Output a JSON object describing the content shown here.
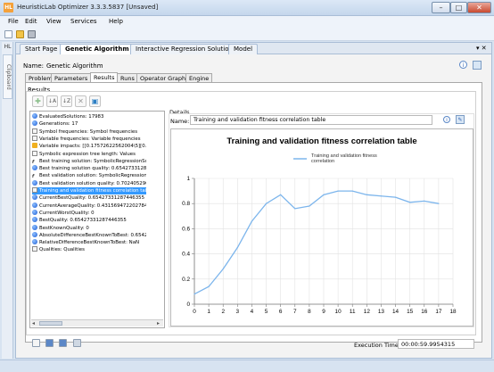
{
  "window": {
    "app_icon": "HL",
    "title": "HeuristicLab Optimizer 3.3.3.5837 [Unsaved]",
    "buttons": {
      "minimize": "–",
      "maximize": "□",
      "close": "✕"
    }
  },
  "menu": [
    "File",
    "Edit",
    "View",
    "Services",
    "Help"
  ],
  "toolbar_icons": [
    "new-file-icon",
    "open-folder-icon",
    "save-icon"
  ],
  "left_strip": {
    "top_tab": "HL",
    "clipboard_tab": "Clipboard"
  },
  "doc_tabs": [
    {
      "label": "Start Page",
      "active": false
    },
    {
      "label": "Genetic Algorithm",
      "active": true
    },
    {
      "label": "Interactive Regression Solution S...",
      "active": false
    },
    {
      "label": "Model",
      "active": false
    }
  ],
  "doc_menu_glyph": "▾ ✕",
  "name_row": {
    "label": "Name:",
    "value": "Genetic Algorithm"
  },
  "sub_tabs": [
    "Problem",
    "Parameters",
    "Results",
    "Runs",
    "Operator Graph",
    "Engine"
  ],
  "active_sub_tab": "Results",
  "results": {
    "group_label": "Results",
    "toolbar": [
      "add-icon",
      "sort-ascending-icon",
      "sort-descending-icon",
      "remove-icon",
      "refresh-icon"
    ],
    "toolbar_glyphs": [
      "✚",
      "↓A",
      "↓Z",
      "✕",
      "▣"
    ],
    "items": [
      {
        "icon": "dot",
        "text": "EvaluatedSolutions: 17983"
      },
      {
        "icon": "dot",
        "text": "Generations: 17"
      },
      {
        "icon": "chart",
        "text": "Symbol frequencies: Symbol frequencies"
      },
      {
        "icon": "chart",
        "text": "Variable frequencies: Variable frequencies"
      },
      {
        "icon": "vi",
        "text": "Variable impacts: [[0.17572622562004\\5][0.137"
      },
      {
        "icon": "chart",
        "text": "Symbolic expression tree length: Values"
      },
      {
        "icon": "fx",
        "text": "Best training solution: SymbolicRegressionSolu"
      },
      {
        "icon": "dot",
        "text": "Best training solution quality: 0.654273312874"
      },
      {
        "icon": "fx",
        "text": "Best validation solution: SymbolicRegressionS"
      },
      {
        "icon": "dot",
        "text": "Best validation solution quality: 0.70240529696"
      },
      {
        "icon": "chart",
        "text": "Training and validation fitness correlation table",
        "selected": true
      },
      {
        "icon": "dot",
        "text": "CurrentBestQuality: 0.65427331287446355"
      },
      {
        "icon": "dot",
        "text": "CurrentAverageQuality: 0.4315694722027848"
      },
      {
        "icon": "dot",
        "text": "CurrentWorstQuality: 0"
      },
      {
        "icon": "dot",
        "text": "BestQuality: 0.65427331287446355"
      },
      {
        "icon": "dot",
        "text": "BestKnownQuality: 0"
      },
      {
        "icon": "dot",
        "text": "AbsoluteDifferenceBestKnownToBest: 0.6542"
      },
      {
        "icon": "dot",
        "text": "RelativeDifferenceBestKnownToBest: NaN"
      },
      {
        "icon": "chart",
        "text": "Qualities: Qualities"
      }
    ]
  },
  "details": {
    "group_label": "Details",
    "name_label": "Name:",
    "name_value": "Training and validation fitness correlation table",
    "info_icon": "i",
    "edit_icon": "✎"
  },
  "chart_data": {
    "type": "line",
    "title": "Training and validation fitness correlation table",
    "series": [
      {
        "name": "Training and validation fitness correlation",
        "color": "#7cb5ec",
        "x": [
          0,
          1,
          2,
          3,
          4,
          5,
          6,
          7,
          8,
          9,
          10,
          11,
          12,
          13,
          14,
          15,
          16,
          17
        ],
        "values": [
          0.08,
          0.14,
          0.28,
          0.45,
          0.66,
          0.8,
          0.87,
          0.76,
          0.78,
          0.87,
          0.9,
          0.9,
          0.87,
          0.86,
          0.85,
          0.81,
          0.82,
          0.8
        ]
      }
    ],
    "xlim": [
      0,
      18
    ],
    "ylim": [
      0,
      1
    ],
    "x_ticks": [
      0,
      1,
      2,
      3,
      4,
      5,
      6,
      7,
      8,
      9,
      10,
      11,
      12,
      13,
      14,
      15,
      16,
      17,
      18
    ],
    "y_ticks": [
      0,
      0.2,
      0.4,
      0.6,
      0.8,
      1
    ],
    "grid": true,
    "legend": "top-right"
  },
  "bottom_buttons": [
    "play-icon",
    "pause-icon",
    "stop-icon",
    "reset-icon"
  ],
  "execution_time": {
    "label": "Execution Time:",
    "value": "00:00:59.9954315"
  }
}
